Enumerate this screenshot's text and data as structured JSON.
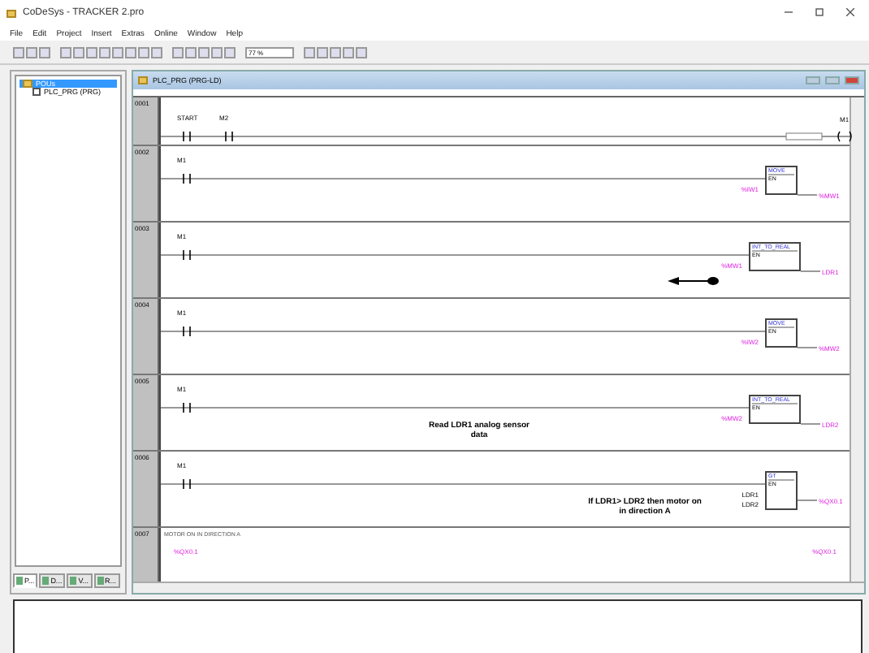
{
  "window": {
    "title": "CoDeSys - TRACKER 2.pro"
  },
  "menu": [
    "File",
    "Edit",
    "Project",
    "Insert",
    "Extras",
    "Online",
    "Window",
    "Help"
  ],
  "toolbar": {
    "zoom": "77 %"
  },
  "tree": {
    "items": [
      {
        "label": "POUs",
        "selected": true,
        "children": [
          {
            "label": "PLC_PRG (PRG)",
            "selected": false
          }
        ]
      }
    ]
  },
  "panel_tabs": [
    {
      "label": "P...",
      "selected": true
    },
    {
      "label": "D...",
      "selected": false
    },
    {
      "label": "V...",
      "selected": false
    },
    {
      "label": "R...",
      "selected": false
    }
  ],
  "editor": {
    "title": "PLC_PRG (PRG-LD)",
    "rungs": [
      {
        "number": "0001",
        "kind": "coil",
        "contacts": [
          "START",
          "M2"
        ],
        "coil": "M1"
      },
      {
        "number": "0002",
        "kind": "block",
        "contacts": [
          "M1"
        ],
        "block": "MOVE",
        "en": "EN",
        "inputs": [
          "%IW1"
        ],
        "output": "%MW1"
      },
      {
        "number": "0003",
        "kind": "block",
        "contacts": [
          "M1"
        ],
        "block": "INT_TO_REAL",
        "en": "EN",
        "inputs": [
          "%MW1"
        ],
        "output": "LDR1",
        "arrow": true
      },
      {
        "number": "0004",
        "kind": "block",
        "contacts": [
          "M1"
        ],
        "block": "MOVE",
        "en": "EN",
        "inputs": [
          "%IW2"
        ],
        "output": "%MW2"
      },
      {
        "number": "0005",
        "kind": "block",
        "contacts": [
          "M1"
        ],
        "block": "INT_TO_REAL",
        "en": "EN",
        "inputs": [
          "%MW2"
        ],
        "output": "LDR2",
        "comment": "Read LDR1 analog sensor data"
      },
      {
        "number": "0006",
        "kind": "block",
        "contacts": [
          "M1"
        ],
        "block": "GT",
        "en": "EN",
        "inputs": [
          "LDR1",
          "LDR2"
        ],
        "output": "%QX0.1",
        "comment": "If LDR1> LDR2 then motor on in direction A"
      },
      {
        "number": "0007",
        "kind": "partial",
        "note": "MOTOR ON IN DIRECTION A",
        "left": "%QX0.1",
        "right": "%QX0.1"
      }
    ]
  }
}
